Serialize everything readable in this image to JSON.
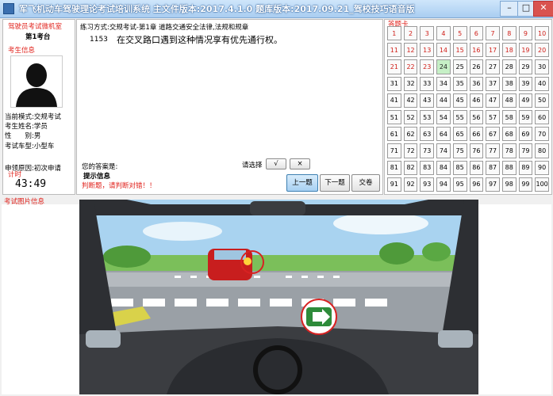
{
  "window": {
    "title": "军飞机动车驾驶理论考试培训系统 主文件版本:2017.4.1.0 题库版本:2017.09.21_驾校技巧语音版"
  },
  "left": {
    "room_title": "驾驶员考试微机室",
    "seat": "第1考台",
    "student_info_label": "考生信息",
    "info": [
      {
        "key": "当前模式:",
        "value": "交规考试"
      },
      {
        "key": "考生姓名:",
        "value": "学员"
      },
      {
        "key": "性　　别:",
        "value": "男"
      },
      {
        "key": "考试车型:",
        "value": "小型车"
      }
    ],
    "apply_reason": "申领原因:初次申请",
    "timer_label": "计时",
    "timer_value": "43:49"
  },
  "question": {
    "mode_line": "练习方式:交规考试-第1章 道路交通安全法律,法规和规章",
    "number": "1153",
    "text": "在交叉路口遇到这种情况享有优先通行权。",
    "answer_label": "您的答案是:",
    "choose_label": "请选择",
    "right_btn": "√",
    "wrong_btn": "×",
    "hint_title": "提示信息",
    "hint_text": "判断题，请判断对错！！"
  },
  "nav": {
    "prev": "上一题",
    "next": "下一题",
    "submit": "交卷"
  },
  "answer_card": {
    "title": "答题卡",
    "current": 24,
    "done_count": 23,
    "cells": [
      "1",
      "2",
      "3",
      "4",
      "5",
      "6",
      "7",
      "8",
      "9",
      "10",
      "11",
      "12",
      "13",
      "14",
      "15",
      "16",
      "17",
      "18",
      "19",
      "20",
      "21",
      "22",
      "23",
      "24",
      "25",
      "26",
      "27",
      "28",
      "29",
      "30",
      "31",
      "32",
      "33",
      "34",
      "35",
      "36",
      "37",
      "38",
      "39",
      "40",
      "41",
      "42",
      "43",
      "44",
      "45",
      "46",
      "47",
      "48",
      "49",
      "50",
      "51",
      "52",
      "53",
      "54",
      "55",
      "56",
      "57",
      "58",
      "59",
      "60",
      "61",
      "62",
      "63",
      "64",
      "65",
      "66",
      "67",
      "68",
      "69",
      "70",
      "71",
      "72",
      "73",
      "74",
      "75",
      "76",
      "77",
      "78",
      "79",
      "80",
      "81",
      "82",
      "83",
      "84",
      "85",
      "86",
      "87",
      "88",
      "89",
      "90",
      "91",
      "92",
      "93",
      "94",
      "95",
      "96",
      "97",
      "98",
      "99",
      "100"
    ]
  },
  "image_section": {
    "label": "考试图片信息"
  },
  "colors": {
    "accent_red": "#e0201a",
    "current_green": "#c6f0c6",
    "highlight_blue": "#a7d0f2"
  }
}
